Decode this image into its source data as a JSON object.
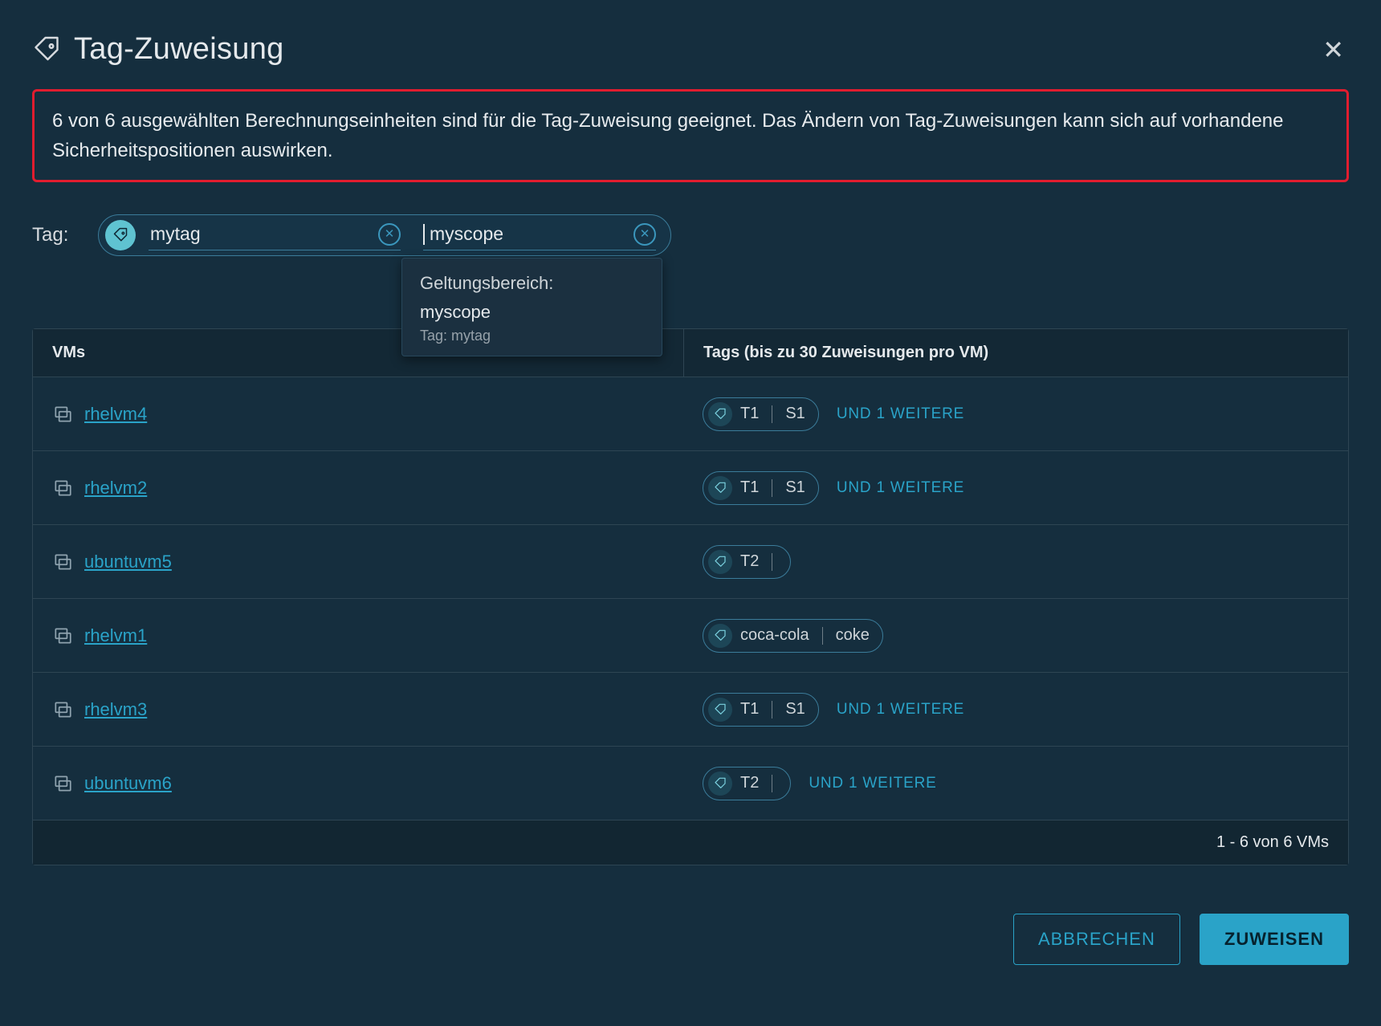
{
  "header": {
    "title": "Tag-Zuweisung"
  },
  "alert": {
    "text": "6 von 6 ausgewählten Berechnungseinheiten sind für die Tag-Zuweisung geeignet. Das Ändern von Tag-Zuweisungen kann sich auf vorhandene Sicherheitspositionen auswirken."
  },
  "tag_row": {
    "label": "Tag:",
    "tag_value": "mytag",
    "scope_value": "myscope"
  },
  "popover": {
    "title": "Geltungsbereich:",
    "scope": "myscope",
    "tag_line": "Tag: mytag"
  },
  "table": {
    "columns": {
      "vms": "VMs",
      "tags": "Tags (bis zu 30 Zuweisungen pro VM)"
    },
    "rows": [
      {
        "vm": "rhelvm4",
        "chip_t": "T1",
        "chip_s": "S1",
        "more": "UND 1 WEITERE"
      },
      {
        "vm": "rhelvm2",
        "chip_t": "T1",
        "chip_s": "S1",
        "more": "UND 1 WEITERE"
      },
      {
        "vm": "ubuntuvm5",
        "chip_t": "T2",
        "chip_s": "",
        "more": ""
      },
      {
        "vm": "rhelvm1",
        "chip_t": "coca-cola",
        "chip_s": "coke",
        "more": ""
      },
      {
        "vm": "rhelvm3",
        "chip_t": "T1",
        "chip_s": "S1",
        "more": "UND 1 WEITERE"
      },
      {
        "vm": "ubuntuvm6",
        "chip_t": "T2",
        "chip_s": "",
        "more": "UND 1 WEITERE"
      }
    ],
    "footer": "1 - 6 von 6 VMs"
  },
  "buttons": {
    "cancel": "ABBRECHEN",
    "assign": "ZUWEISEN"
  }
}
